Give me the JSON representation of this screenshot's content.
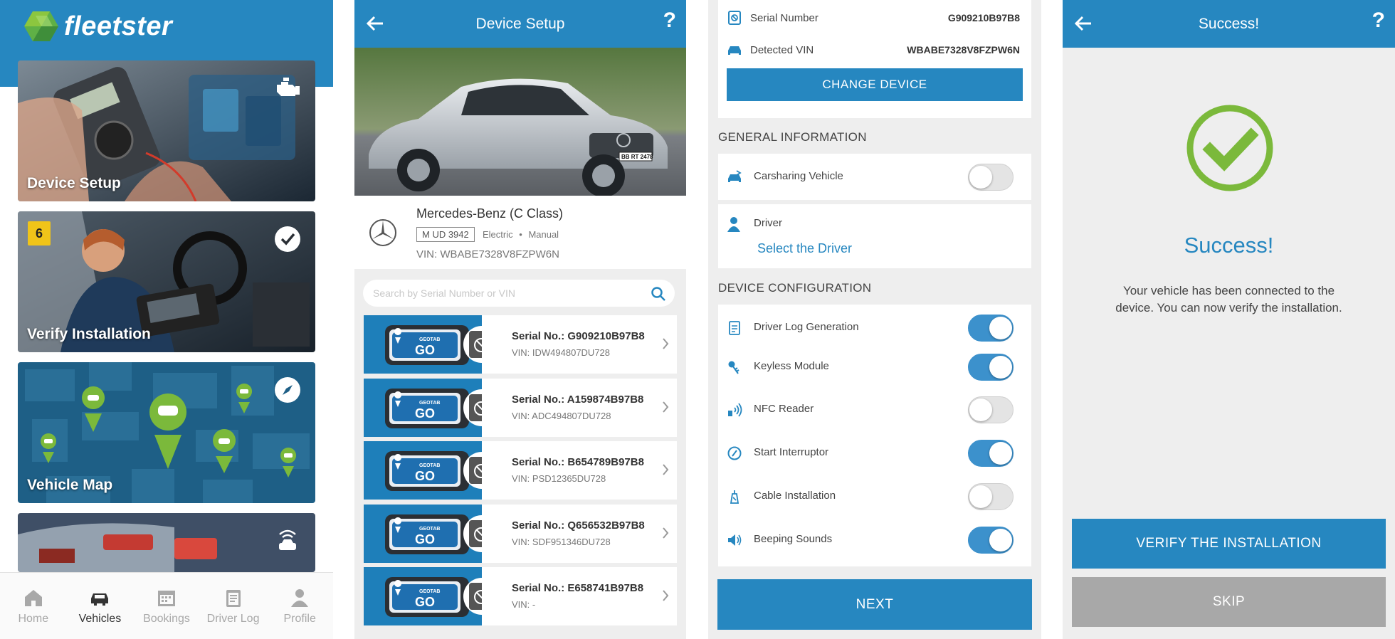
{
  "home": {
    "brand": "fleetster",
    "tiles": [
      {
        "label": "Device Setup",
        "icon": "engine-icon"
      },
      {
        "label": "Verify Installation",
        "icon": "check-circle-icon",
        "badge": "6"
      },
      {
        "label": "Vehicle Map",
        "icon": "compass-icon"
      },
      {
        "label": "",
        "icon": "wireless-car-icon"
      }
    ],
    "nav": [
      {
        "label": "Home",
        "icon": "home-icon",
        "active": false
      },
      {
        "label": "Vehicles",
        "icon": "car-icon",
        "active": true
      },
      {
        "label": "Bookings",
        "icon": "calendar-icon",
        "active": false
      },
      {
        "label": "Driver Log",
        "icon": "clipboard-icon",
        "active": false
      },
      {
        "label": "Profile",
        "icon": "person-icon",
        "active": false
      }
    ]
  },
  "device_setup": {
    "title": "Device Setup",
    "help": "?",
    "vehicle": {
      "name": "Mercedes-Benz (C Class)",
      "plate": "M UD 3942",
      "fuel": "Electric",
      "transmission": "Manual",
      "separator": "•",
      "vin": "VIN: WBABE7328V8FZPW6N",
      "photo_plate": "BB RT 2478"
    },
    "search_placeholder": "Search by Serial Number or VIN",
    "devices": [
      {
        "serial": "Serial No.: G909210B97B8",
        "vin": "VIN: IDW494807DU728"
      },
      {
        "serial": "Serial No.: A159874B97B8",
        "vin": "VIN: ADC494807DU728"
      },
      {
        "serial": "Serial No.: B654789B97B8",
        "vin": "VIN: PSD12365DU728"
      },
      {
        "serial": "Serial No.: Q656532B97B8",
        "vin": "VIN: SDF951346DU728"
      },
      {
        "serial": "Serial No.: E658741B97B8",
        "vin": "VIN: -"
      }
    ],
    "device_brand": "GEOTAB",
    "device_model": "GO"
  },
  "config": {
    "serial_label": "Serial Number",
    "serial_value": "G909210B97B8",
    "vin_label": "Detected VIN",
    "vin_value": "WBABE7328V8FZPW6N",
    "change_device": "CHANGE DEVICE",
    "general_title": "GENERAL INFORMATION",
    "carsharing_label": "Carsharing Vehicle",
    "carsharing_on": false,
    "driver_label": "Driver",
    "driver_action": "Select the Driver",
    "device_config_title": "DEVICE CONFIGURATION",
    "options": [
      {
        "label": "Driver Log Generation",
        "icon": "clipboard-icon",
        "on": true
      },
      {
        "label": "Keyless Module",
        "icon": "keys-icon",
        "on": true
      },
      {
        "label": "NFC Reader",
        "icon": "nfc-icon",
        "on": false
      },
      {
        "label": "Start Interruptor",
        "icon": "interrupt-icon",
        "on": true
      },
      {
        "label": "Cable Installation",
        "icon": "cable-icon",
        "on": false
      },
      {
        "label": "Beeping Sounds",
        "icon": "speaker-icon",
        "on": true
      }
    ],
    "next": "NEXT"
  },
  "success": {
    "header": "Success!",
    "help": "?",
    "title": "Success!",
    "message": "Your vehicle has been connected to the device. You can now verify the installation.",
    "verify": "VERIFY THE INSTALLATION",
    "skip": "SKIP"
  },
  "colors": {
    "primary": "#2687c0",
    "success_green": "#7bb93b",
    "toggle_on": "#3c91cc",
    "badge": "#f0c419",
    "skip_grey": "#a8a8a8"
  }
}
